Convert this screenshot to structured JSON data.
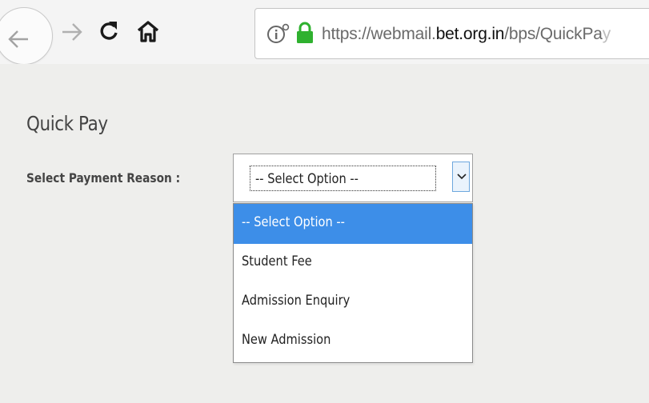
{
  "browser": {
    "url": {
      "prefix": "https://webmail.",
      "host": "bet.org.in",
      "path": "/bps/QuickPa",
      "faded": "y"
    },
    "icons": {
      "back": "back-arrow-icon",
      "forward": "forward-arrow-icon",
      "reload": "reload-icon",
      "home": "home-icon",
      "site_info": "info-icon",
      "secure": "lock-icon"
    },
    "colors": {
      "lock": "#2fb12f"
    }
  },
  "page": {
    "title": "Quick Pay",
    "field_label": "Select Payment Reason :",
    "select": {
      "value": "-- Select Option --",
      "options": [
        {
          "label": "-- Select Option --",
          "selected": true
        },
        {
          "label": "Student Fee",
          "selected": false
        },
        {
          "label": "Admission Enquiry",
          "selected": false
        },
        {
          "label": "New Admission",
          "selected": false
        }
      ]
    },
    "colors": {
      "highlight": "#3d8ee8"
    }
  }
}
